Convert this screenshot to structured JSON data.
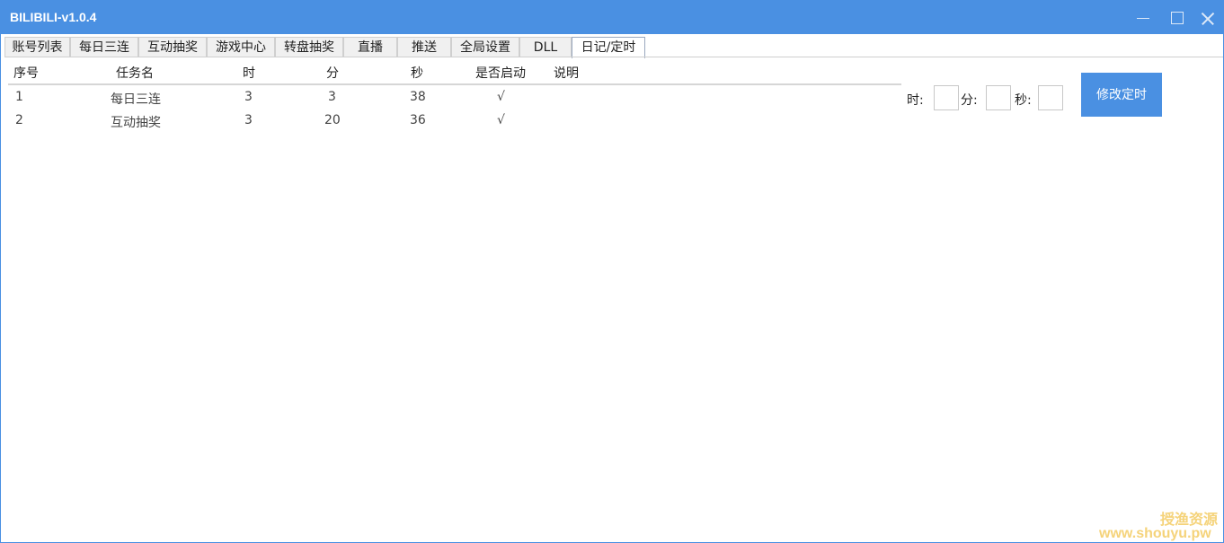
{
  "window": {
    "title": "BILIBILI-v1.0.4"
  },
  "tabs": [
    {
      "label": "账号列表"
    },
    {
      "label": "每日三连"
    },
    {
      "label": "互动抽奖"
    },
    {
      "label": "游戏中心"
    },
    {
      "label": "转盘抽奖"
    },
    {
      "label": "直播"
    },
    {
      "label": "推送"
    },
    {
      "label": "全局设置"
    },
    {
      "label": "DLL"
    },
    {
      "label": "日记/定时"
    }
  ],
  "active_tab": "日记/定时",
  "table": {
    "columns": [
      "序号",
      "任务名",
      "时",
      "分",
      "秒",
      "是否启动",
      "说明"
    ],
    "rows": [
      {
        "index": "1",
        "task": "每日三连",
        "hour": "3",
        "minute": "3",
        "second": "38",
        "enabled": "√",
        "note": ""
      },
      {
        "index": "2",
        "task": "互动抽奖",
        "hour": "3",
        "minute": "20",
        "second": "36",
        "enabled": "√",
        "note": ""
      }
    ]
  },
  "time_editor": {
    "hour_label": "时:",
    "minute_label": "分:",
    "second_label": "秒:",
    "hour_value": "",
    "minute_value": "",
    "second_value": "",
    "submit_label": "修改定时"
  },
  "watermark": {
    "line1": "授渔资源",
    "line2": "www.shouyu.pw"
  },
  "colors": {
    "accent": "#4a90e2",
    "watermark": "#f5d37a"
  }
}
